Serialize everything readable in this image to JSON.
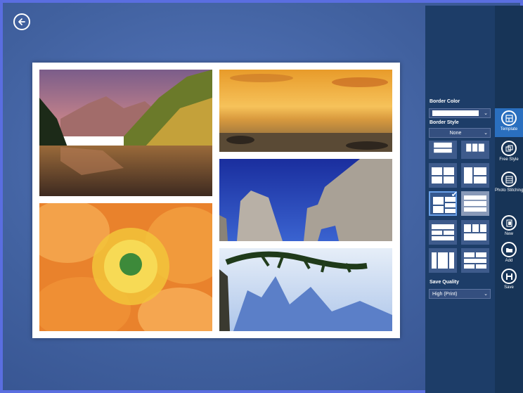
{
  "header": {
    "back_icon": "back-arrow-icon"
  },
  "panel": {
    "border_color_label": "Border Color",
    "border_color_value": "#ffffff",
    "border_style_label": "Border Style",
    "border_style_value": "None",
    "save_quality_label": "Save Quality",
    "save_quality_value": "High (Print)"
  },
  "templates": {
    "count": 10,
    "selected_index": 4
  },
  "commands": {
    "template": "Template",
    "free_style": "Free Style",
    "photo_stitching": "Photo Stitching",
    "new": "New",
    "add": "Add",
    "save": "Save"
  },
  "photos": [
    "mountain-lake-photo",
    "sunset-sea-photo",
    "rock-arch-photo",
    "orange-flower-photo",
    "pine-mountain-photo"
  ],
  "colors": {
    "panel": "#1d3d68",
    "accent": "#2a6fbf",
    "background": "#41619f"
  }
}
